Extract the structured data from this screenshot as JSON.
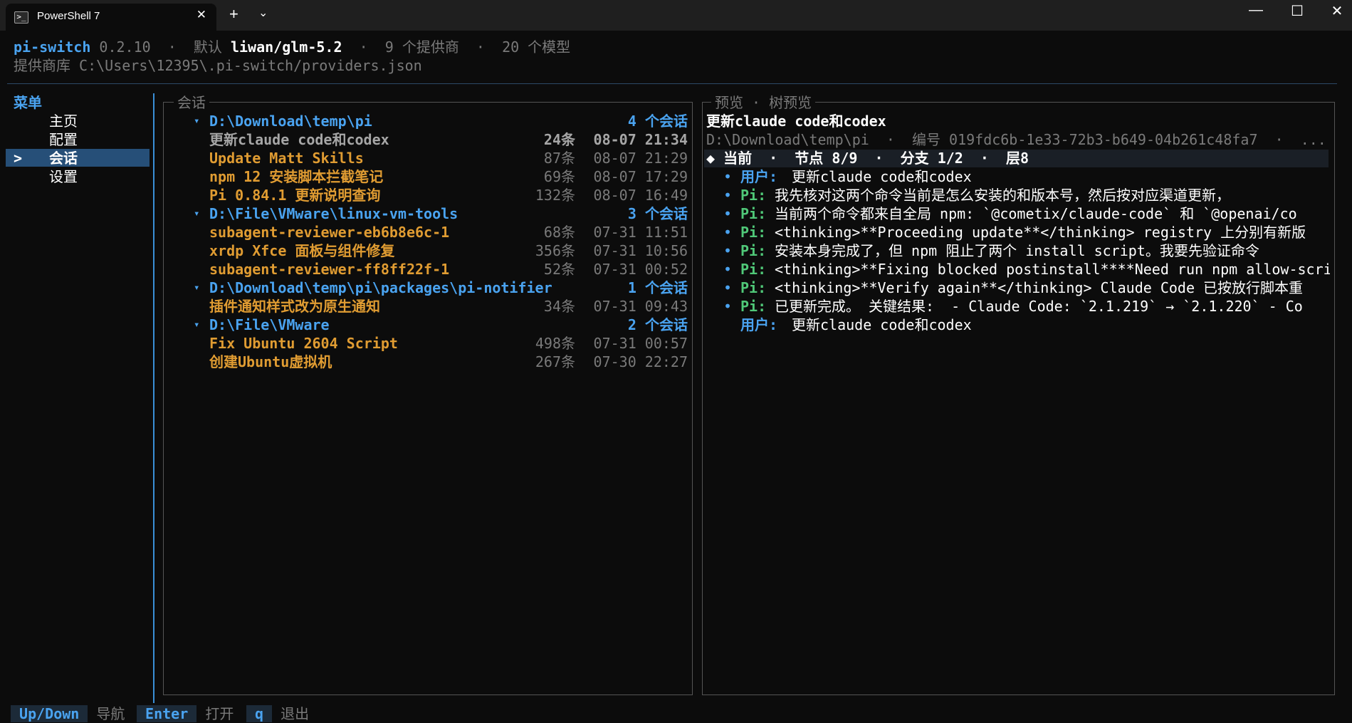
{
  "window": {
    "tab_title": "PowerShell 7",
    "tab_icon": "powershell-icon",
    "tab_close": "✕",
    "new_tab": "+",
    "dropdown": "⌄",
    "minimize": "—",
    "maximize": "☐",
    "close": "✕"
  },
  "header": {
    "app_name": "pi-switch",
    "version": "0.2.10",
    "sep": "·",
    "default_label": "默认",
    "default_model": "liwan/glm-5.2",
    "providers_count": "9 个提供商",
    "models_count": "20 个模型",
    "repo_label": "提供商库",
    "repo_path": "C:\\Users\\12395\\.pi-switch/providers.json"
  },
  "menu": {
    "title": "菜单",
    "selected_marker": ">",
    "items": [
      {
        "label": "主页",
        "selected": false
      },
      {
        "label": "配置",
        "selected": false
      },
      {
        "label": "会话",
        "selected": true
      },
      {
        "label": "设置",
        "selected": false
      }
    ]
  },
  "sessions": {
    "title": "会话",
    "groups": [
      {
        "arrow": "▾",
        "path": "D:\\Download\\temp\\pi",
        "count": "4 个会话",
        "items": [
          {
            "name": "更新claude code和codex",
            "msgs": "24条",
            "time": "08-07 21:34",
            "selected": true
          },
          {
            "name": "Update Matt Skills",
            "msgs": "87条",
            "time": "08-07 21:29"
          },
          {
            "name": "npm 12 安装脚本拦截笔记",
            "msgs": "69条",
            "time": "08-07 17:29"
          },
          {
            "name": "Pi 0.84.1 更新说明查询",
            "msgs": "132条",
            "time": "08-07 16:49"
          }
        ]
      },
      {
        "arrow": "▾",
        "path": "D:\\File\\VMware\\linux-vm-tools",
        "count": "3 个会话",
        "items": [
          {
            "name": "subagent-reviewer-eb6b8e6c-1",
            "msgs": "68条",
            "time": "07-31 11:51"
          },
          {
            "name": "xrdp Xfce 面板与组件修复",
            "msgs": "356条",
            "time": "07-31 10:56"
          },
          {
            "name": "subagent-reviewer-ff8ff22f-1",
            "msgs": "52条",
            "time": "07-31 00:52"
          }
        ]
      },
      {
        "arrow": "▾",
        "path": "D:\\Download\\temp\\pi\\packages\\pi-notifier",
        "count": "1 个会话",
        "items": [
          {
            "name": "插件通知样式改为原生通知",
            "msgs": "34条",
            "time": "07-31 09:43"
          }
        ]
      },
      {
        "arrow": "▾",
        "path": "D:\\File\\VMware",
        "count": "2 个会话",
        "items": [
          {
            "name": "Fix Ubuntu 2604 Script",
            "msgs": "498条",
            "time": "07-31 00:57"
          },
          {
            "name": "创建Ubuntu虚拟机",
            "msgs": "267条",
            "time": "07-30 22:27"
          }
        ]
      }
    ]
  },
  "preview": {
    "title": "预览 · 树预览",
    "heading": "更新claude code和codex",
    "meta": "D:\\Download\\temp\\pi  ·  编号 019fdc6b-1e33-72b3-b649-04b261c48fa7  ·  ...",
    "current_line": "◆ 当前  ·  节点 8/9  ·  分支 1/2  ·  层8",
    "messages": [
      {
        "bullet": "•",
        "role": "用户:",
        "type": "user",
        "text": "更新claude code和codex"
      },
      {
        "bullet": "•",
        "role": "Pi:",
        "type": "pi",
        "text": "我先核对这两个命令当前是怎么安装的和版本号，然后按对应渠道更新，"
      },
      {
        "bullet": "•",
        "role": "Pi:",
        "type": "pi",
        "text": "当前两个命令都来自全局 npm: `@cometix/claude-code` 和 `@openai/co"
      },
      {
        "bullet": "•",
        "role": "Pi:",
        "type": "pi",
        "text": "<thinking>**Proceeding update**</thinking> registry 上分别有新版"
      },
      {
        "bullet": "•",
        "role": "Pi:",
        "type": "pi",
        "text": "安装本身完成了，但 npm 阻止了两个 install script。我要先验证命令"
      },
      {
        "bullet": "•",
        "role": "Pi:",
        "type": "pi",
        "text": "<thinking>**Fixing blocked postinstall****Need run npm allow-scri"
      },
      {
        "bullet": "•",
        "role": "Pi:",
        "type": "pi",
        "text": "<thinking>**Verify again**</thinking> Claude Code 已按放行脚本重"
      },
      {
        "bullet": "•",
        "role": "Pi:",
        "type": "pi",
        "text": "已更新完成。 关键结果:  - Claude Code: `2.1.219` → `2.1.220` - Co"
      },
      {
        "bullet": "",
        "role": "用户:",
        "type": "user",
        "text": "更新claude code和codex"
      }
    ]
  },
  "footer": [
    {
      "key": "Up/Down",
      "label": "导航"
    },
    {
      "key": "Enter",
      "label": "打开"
    },
    {
      "key": "q",
      "label": "退出"
    }
  ]
}
